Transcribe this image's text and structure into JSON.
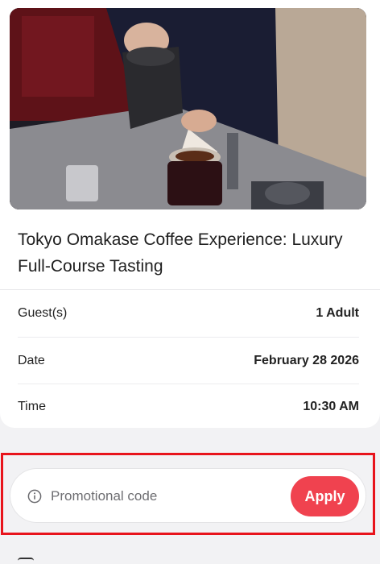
{
  "product": {
    "title": "Tokyo Omakase Coffee Experience: Luxury Full-Course Tasting",
    "image_icon": "coffee-pour-photo"
  },
  "details": [
    {
      "label": "Guest(s)",
      "value": "1 Adult"
    },
    {
      "label": "Date",
      "value": "February 28 2026"
    },
    {
      "label": "Time",
      "value": "10:30 AM"
    }
  ],
  "promo": {
    "placeholder": "Promotional code",
    "icon": "info-icon",
    "apply_label": "Apply",
    "accent_color": "#f0424f",
    "highlight_color": "#e8141c"
  }
}
